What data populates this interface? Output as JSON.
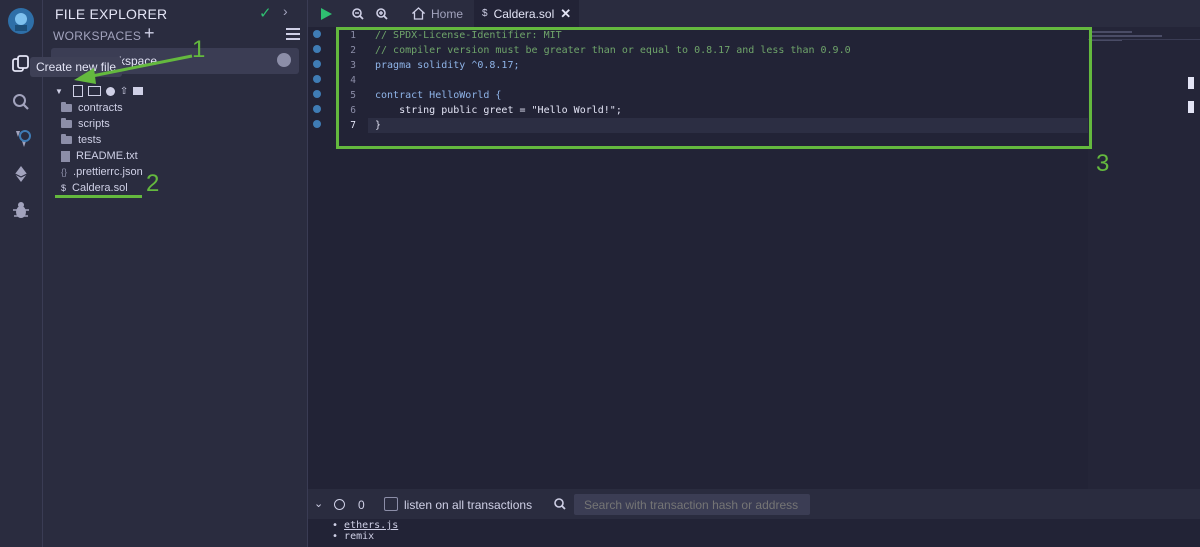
{
  "side_panel": {
    "title": "FILE EXPLORER",
    "workspaces_label": "WORKSPACES",
    "workspace_select_value": "kspace",
    "tooltip": "Create new file"
  },
  "file_tree": [
    {
      "type": "folder",
      "name": "contracts"
    },
    {
      "type": "folder",
      "name": "scripts"
    },
    {
      "type": "folder",
      "name": "tests"
    },
    {
      "type": "file",
      "name": "README.txt",
      "icon": "file-icon"
    },
    {
      "type": "file",
      "name": ".prettierrc.json",
      "icon": "braces-icon"
    },
    {
      "type": "file",
      "name": "Caldera.sol",
      "icon": "solidity-icon"
    }
  ],
  "tabs": [
    {
      "label": "Home",
      "icon": "home-icon"
    },
    {
      "label": "Caldera.sol",
      "active": true
    }
  ],
  "editor": {
    "line_numbers": [
      "1",
      "2",
      "3",
      "4",
      "5",
      "6",
      "7"
    ],
    "lines": [
      "// SPDX-License-Identifier: MIT",
      "// compiler version must be greater than or equal to 0.8.17 and less than 0.9.0",
      "pragma solidity ^0.8.17;",
      "",
      "contract HelloWorld {",
      "    string public greet = \"Hello World!\";",
      "}"
    ],
    "current_line": "7"
  },
  "terminal": {
    "counter": "0",
    "listen_label": "listen on all transactions",
    "search_placeholder": "Search with transaction hash or address",
    "libs": [
      "ethers.js",
      "remix"
    ]
  },
  "annotations": [
    "1",
    "2",
    "3"
  ],
  "colors": {
    "accent_green": "#64b93e",
    "check_green": "#2fbf71",
    "gutter_blue": "#3f7cb5"
  }
}
